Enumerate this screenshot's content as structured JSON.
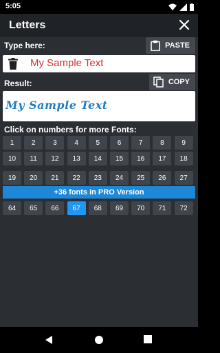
{
  "status": {
    "time": "5:05"
  },
  "appbar": {
    "title": "Letters"
  },
  "input_section": {
    "label": "Type here:",
    "paste_label": "PASTE",
    "value": "My Sample Text"
  },
  "result_section": {
    "label": "Result:",
    "copy_label": "COPY",
    "value": "My Sample Text"
  },
  "fonts_section": {
    "label": "Click on numbers for more Fonts:",
    "rows": [
      [
        "1",
        "2",
        "3",
        "4",
        "5",
        "6",
        "7",
        "8",
        "9"
      ],
      [
        "10",
        "11",
        "12",
        "13",
        "14",
        "15",
        "16",
        "17",
        "18"
      ],
      [
        "19",
        "20",
        "21",
        "22",
        "23",
        "24",
        "25",
        "26",
        "27"
      ]
    ],
    "pro_banner": "+36 fonts in PRO Version",
    "pro_row": [
      "64",
      "65",
      "66",
      "67",
      "68",
      "69",
      "70",
      "71",
      "72"
    ],
    "selected": "67"
  },
  "colors": {
    "accent": "#2196f3",
    "input_text": "#d73030",
    "result_text": "#1e7fc3"
  }
}
